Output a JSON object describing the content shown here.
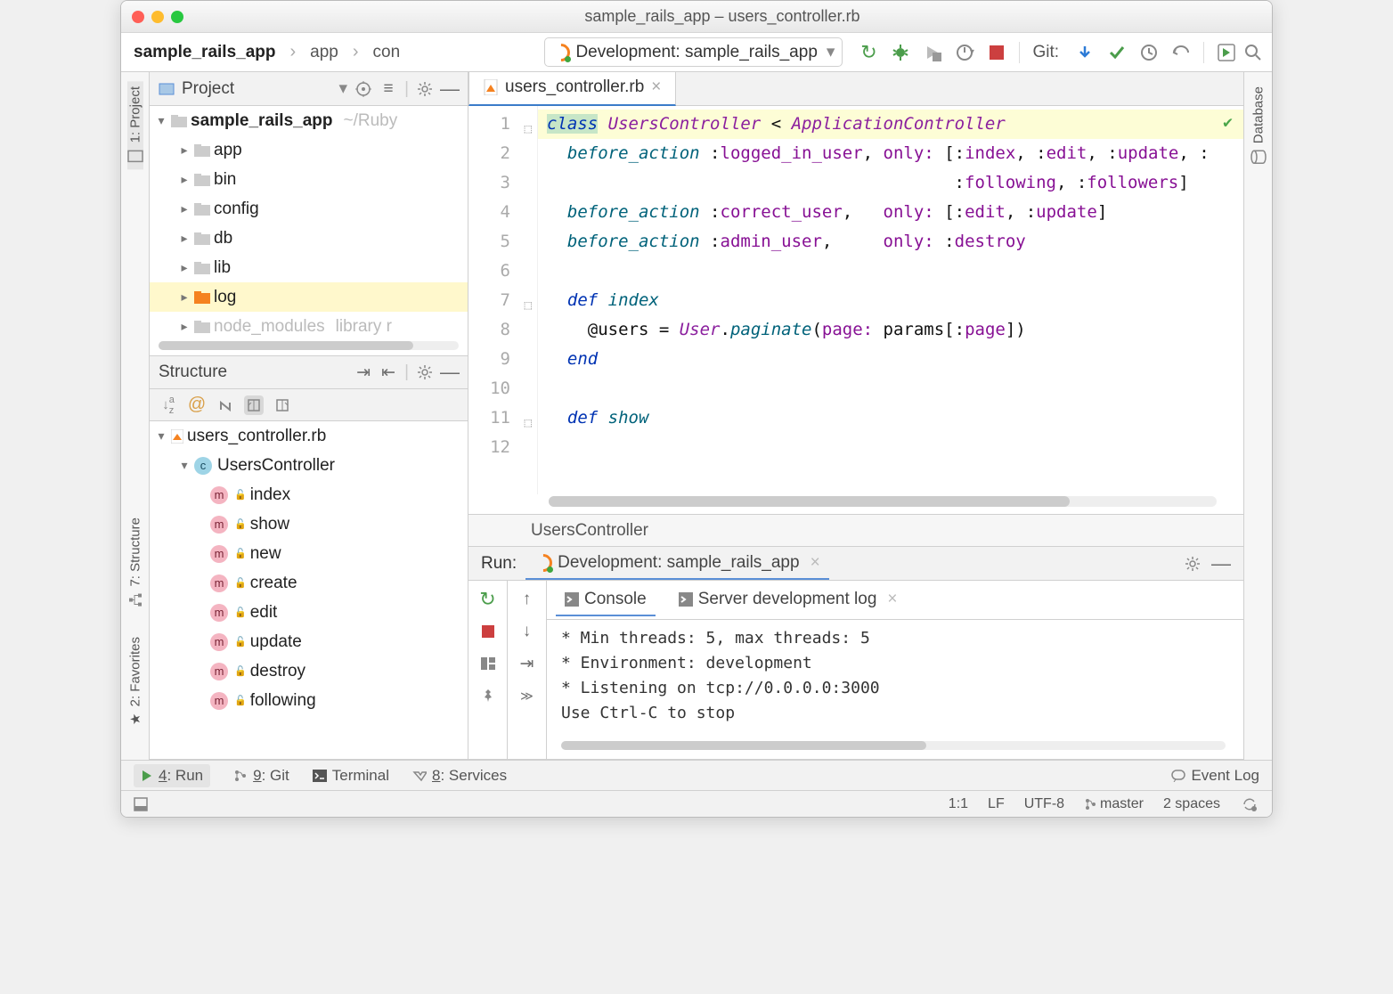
{
  "title": "sample_rails_app – users_controller.rb",
  "breadcrumb": {
    "root": "sample_rails_app",
    "seg1": "app",
    "seg2": "con"
  },
  "run_config": {
    "label": "Development: sample_rails_app"
  },
  "git_label": "Git:",
  "project_panel": {
    "title": "Project",
    "root": {
      "name": "sample_rails_app",
      "path": "~/Ruby"
    },
    "items": [
      {
        "name": "app",
        "sel": false
      },
      {
        "name": "bin",
        "sel": false
      },
      {
        "name": "config",
        "sel": false
      },
      {
        "name": "db",
        "sel": false
      },
      {
        "name": "lib",
        "sel": false
      },
      {
        "name": "log",
        "sel": true,
        "orange": true
      },
      {
        "name": "node_modules",
        "sel": false,
        "muted": true,
        "extra": "library r"
      }
    ]
  },
  "structure_panel": {
    "title": "Structure",
    "file": "users_controller.rb",
    "class": "UsersController",
    "methods": [
      "index",
      "show",
      "new",
      "create",
      "edit",
      "update",
      "destroy",
      "following"
    ]
  },
  "editor": {
    "tab": "users_controller.rb",
    "lines": [
      {
        "n": 1,
        "tokens": [
          {
            "t": "class",
            "c": "kw hl-class"
          },
          {
            "t": " ",
            "c": "pl"
          },
          {
            "t": "UsersController",
            "c": "ident"
          },
          {
            "t": " < ",
            "c": "pl"
          },
          {
            "t": "ApplicationController",
            "c": "ident"
          }
        ]
      },
      {
        "n": 2,
        "tokens": [
          {
            "t": "  ",
            "c": "pl"
          },
          {
            "t": "before_action",
            "c": "cls",
            "i": true
          },
          {
            "t": " :",
            "c": "pl"
          },
          {
            "t": "logged_in_user",
            "c": "sym"
          },
          {
            "t": ", ",
            "c": "pl"
          },
          {
            "t": "only:",
            "c": "sym"
          },
          {
            "t": " [:",
            "c": "pl"
          },
          {
            "t": "index",
            "c": "sym"
          },
          {
            "t": ", :",
            "c": "pl"
          },
          {
            "t": "edit",
            "c": "sym"
          },
          {
            "t": ", :",
            "c": "pl"
          },
          {
            "t": "update",
            "c": "sym"
          },
          {
            "t": ", :",
            "c": "pl"
          }
        ]
      },
      {
        "n": 3,
        "tokens": [
          {
            "t": "                                        :",
            "c": "pl"
          },
          {
            "t": "following",
            "c": "sym"
          },
          {
            "t": ", :",
            "c": "pl"
          },
          {
            "t": "followers",
            "c": "sym"
          },
          {
            "t": "]",
            "c": "pl"
          }
        ]
      },
      {
        "n": 4,
        "tokens": [
          {
            "t": "  ",
            "c": "pl"
          },
          {
            "t": "before_action",
            "c": "cls",
            "i": true
          },
          {
            "t": " :",
            "c": "pl"
          },
          {
            "t": "correct_user",
            "c": "sym"
          },
          {
            "t": ",   ",
            "c": "pl"
          },
          {
            "t": "only:",
            "c": "sym"
          },
          {
            "t": " [:",
            "c": "pl"
          },
          {
            "t": "edit",
            "c": "sym"
          },
          {
            "t": ", :",
            "c": "pl"
          },
          {
            "t": "update",
            "c": "sym"
          },
          {
            "t": "]",
            "c": "pl"
          }
        ]
      },
      {
        "n": 5,
        "tokens": [
          {
            "t": "  ",
            "c": "pl"
          },
          {
            "t": "before_action",
            "c": "cls",
            "i": true
          },
          {
            "t": " :",
            "c": "pl"
          },
          {
            "t": "admin_user",
            "c": "sym"
          },
          {
            "t": ",     ",
            "c": "pl"
          },
          {
            "t": "only:",
            "c": "sym"
          },
          {
            "t": " :",
            "c": "pl"
          },
          {
            "t": "destroy",
            "c": "sym"
          }
        ]
      },
      {
        "n": 6,
        "tokens": []
      },
      {
        "n": 7,
        "tokens": [
          {
            "t": "  ",
            "c": "pl"
          },
          {
            "t": "def",
            "c": "kw"
          },
          {
            "t": " ",
            "c": "pl"
          },
          {
            "t": "index",
            "c": "cls",
            "i": true
          }
        ]
      },
      {
        "n": 8,
        "tokens": [
          {
            "t": "    @users = ",
            "c": "pl"
          },
          {
            "t": "User",
            "c": "ident"
          },
          {
            "t": ".",
            "c": "pl"
          },
          {
            "t": "paginate",
            "c": "cls",
            "i": true
          },
          {
            "t": "(",
            "c": "pl"
          },
          {
            "t": "page:",
            "c": "sym"
          },
          {
            "t": " params[:",
            "c": "pl"
          },
          {
            "t": "page",
            "c": "sym"
          },
          {
            "t": "])",
            "c": "pl"
          }
        ]
      },
      {
        "n": 9,
        "tokens": [
          {
            "t": "  ",
            "c": "pl"
          },
          {
            "t": "end",
            "c": "kw"
          }
        ]
      },
      {
        "n": 10,
        "tokens": []
      },
      {
        "n": 11,
        "tokens": [
          {
            "t": "  ",
            "c": "pl"
          },
          {
            "t": "def",
            "c": "kw"
          },
          {
            "t": " ",
            "c": "pl"
          },
          {
            "t": "show",
            "c": "cls",
            "i": true
          }
        ]
      },
      {
        "n": 12,
        "tokens": []
      }
    ],
    "breadcrumb": "UsersController"
  },
  "run_panel": {
    "label": "Run:",
    "config": "Development: sample_rails_app",
    "tabs": [
      {
        "l": "Console",
        "active": true
      },
      {
        "l": "Server development log",
        "active": false
      }
    ],
    "console": [
      "* Min threads: 5, max threads: 5",
      "* Environment: development",
      "* Listening on tcp://0.0.0.0:3000",
      "Use Ctrl-C to stop"
    ]
  },
  "left_rail": [
    {
      "l": "1: Project",
      "active": true
    },
    {
      "l": "7: Structure",
      "active": false
    },
    {
      "l": "2: Favorites",
      "active": false
    }
  ],
  "right_rail": {
    "l": "Database"
  },
  "bottombar": [
    {
      "l": "4: Run",
      "u": "4",
      "active": true,
      "icon": "run"
    },
    {
      "l": "9: Git",
      "u": "9",
      "icon": "git"
    },
    {
      "l": "Terminal",
      "icon": "term"
    },
    {
      "l": "8: Services",
      "u": "8",
      "icon": "svc"
    }
  ],
  "event_log": "Event Log",
  "status": {
    "pos": "1:1",
    "le": "LF",
    "enc": "UTF-8",
    "branch": "master",
    "spaces": "2 spaces"
  }
}
